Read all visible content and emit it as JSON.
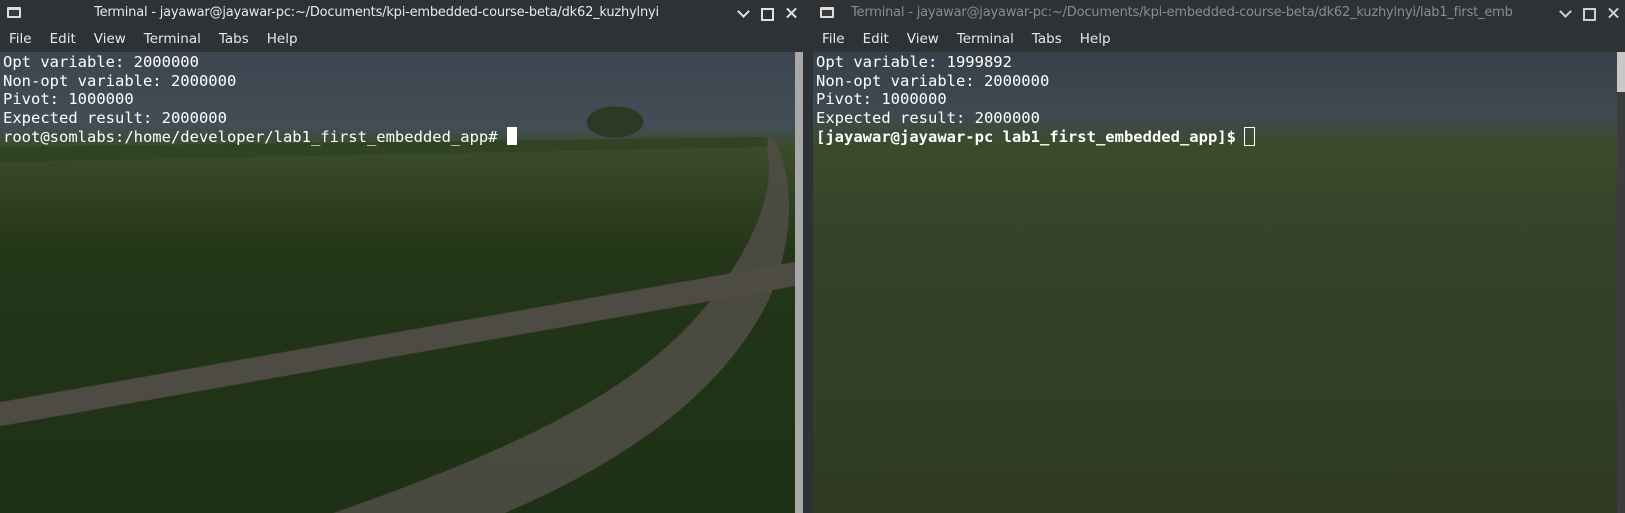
{
  "left_window": {
    "title": "Terminal - jayawar@jayawar-pc:~/Documents/kpi-embedded-course-beta/dk62_kuzhylnyi",
    "menu": [
      "File",
      "Edit",
      "View",
      "Terminal",
      "Tabs",
      "Help"
    ],
    "lines": [
      "Opt variable: 2000000",
      "Non-opt variable: 2000000",
      "Pivot: 1000000",
      "Expected result: 2000000"
    ],
    "prompt": "root@somlabs:/home/developer/lab1_first_embedded_app#"
  },
  "right_window": {
    "title": "Terminal - jayawar@jayawar-pc:~/Documents/kpi-embedded-course-beta/dk62_kuzhylnyi/lab1_first_emb",
    "menu": [
      "File",
      "Edit",
      "View",
      "Terminal",
      "Tabs",
      "Help"
    ],
    "lines": [
      "Opt variable: 1999892",
      "Non-opt variable: 2000000",
      "Pivot: 1000000",
      "Expected result: 2000000"
    ],
    "prompt_user": "[jayawar@jayawar-pc",
    "prompt_dir": "lab1_first_embedded_app",
    "prompt_end": "]$"
  },
  "icons": {
    "terminal": "terminal-icon",
    "minimize": "minimize-icon",
    "maximize": "maximize-icon",
    "close": "close-icon"
  },
  "colors": {
    "chrome": "#2f3234",
    "prompt_green": "#55e04a",
    "text": "#ffffff"
  }
}
